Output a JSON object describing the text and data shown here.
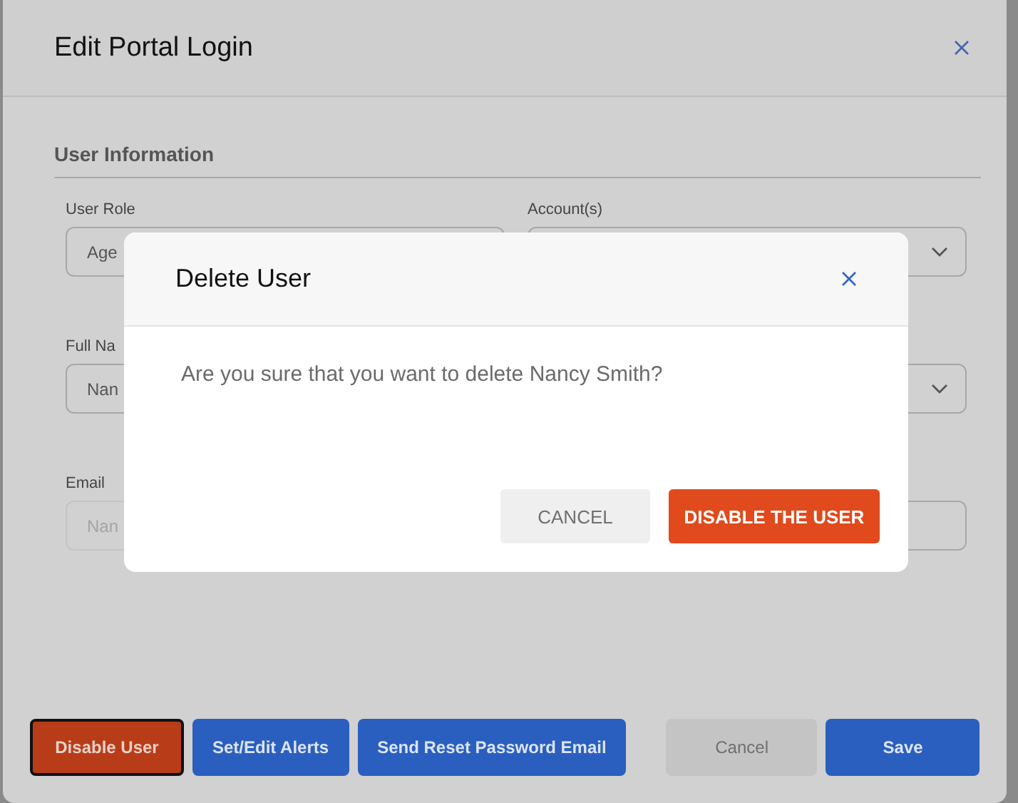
{
  "window": {
    "title": "Edit Portal Login"
  },
  "section": {
    "title": "User Information"
  },
  "fields": [
    {
      "label": "User Role",
      "kind": "text",
      "value": "Age",
      "disabled": false
    },
    {
      "label": "Account(s)",
      "kind": "select",
      "disabled": false
    },
    {
      "label": "Full Na",
      "kind": "text",
      "value": "Nan",
      "disabled": false
    },
    {
      "kind": "select",
      "disabled": false
    },
    {
      "label": "Email",
      "kind": "text",
      "placeholder": "Nan",
      "disabled": true
    },
    {
      "kind": "text",
      "disabled": false
    }
  ],
  "footer_buttons": [
    {
      "label": "Disable User",
      "kind": "danger",
      "focused": true
    },
    {
      "label": "Set/Edit Alerts",
      "kind": "primary",
      "focused": false
    },
    {
      "label": "Send Reset Password Email",
      "kind": "primary",
      "focused": false
    },
    {
      "label": "Cancel",
      "kind": "secondary",
      "focused": false
    },
    {
      "label": "Save",
      "kind": "primary",
      "focused": false
    }
  ],
  "modal": {
    "title": "Delete User",
    "message": "Are you sure that you want to delete Nancy Smith?",
    "buttons": [
      {
        "label": "CANCEL",
        "kind": "secondary"
      },
      {
        "label": "DISABLE THE USER",
        "kind": "danger"
      }
    ]
  }
}
